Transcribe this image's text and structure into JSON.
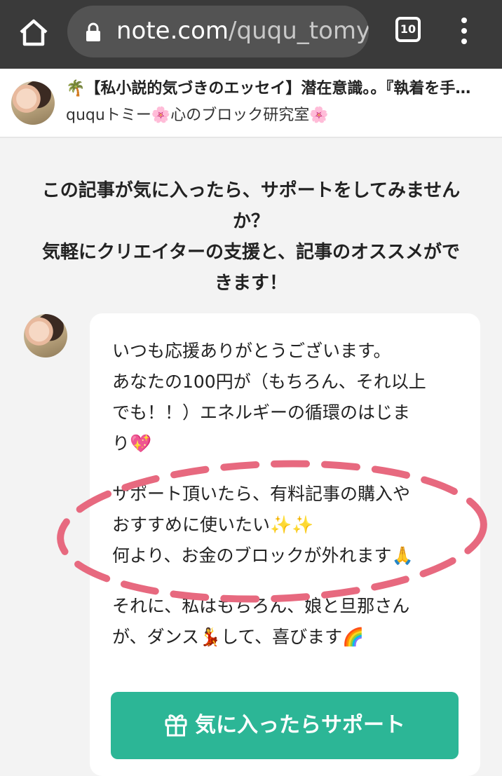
{
  "browser": {
    "url_domain": "note.com",
    "url_path": "/ququ_tomy",
    "tab_count": "10"
  },
  "article_header": {
    "title": "🌴【私小説的気づきのエッセイ】潜在意識。。『執着を手…",
    "author": "ququトミー🌸心のブロック研究室🌸"
  },
  "support": {
    "prompt_lines": [
      "この記事が気に入ったら、サポートをしてみません",
      "か？",
      "気軽にクリエイターの支援と、記事のオススメがで",
      "きます！"
    ],
    "message_paragraphs": [
      [
        "いつも応援ありがとうございます。",
        "あなたの100円が（もちろん、それ以上",
        "でも！！）エネルギーの循環のはじま",
        "り💖"
      ],
      [
        "サポート頂いたら、有料記事の購入や",
        "おすすめに使いたい✨✨",
        "何より、お金のブロックが外れます🙏"
      ],
      [
        "それに、私はもちろん、娘と旦那さん",
        "が、ダンス💃して、喜びます🌈"
      ]
    ],
    "button_label": "気に入ったらサポート"
  },
  "colors": {
    "browser_bar": "#3a3a3a",
    "accent_green": "#2cb696",
    "annotation_pink": "#e7697f"
  }
}
